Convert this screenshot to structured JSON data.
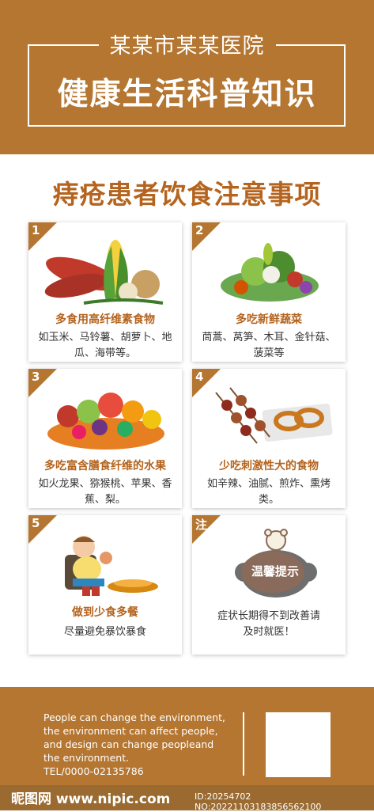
{
  "header": {
    "hospital": "某某市某某医院",
    "title": "健康生活科普知识"
  },
  "section_title": "痔疮患者饮食注意事项",
  "cards": [
    {
      "num": "1",
      "title": "多食用高纤维素食物",
      "desc": "如玉米、马铃薯、胡萝卜、地瓜、海带等。",
      "icon": "vegetables-illustration"
    },
    {
      "num": "2",
      "title": "多吃新鲜蔬菜",
      "desc": "茼蒿、莴笋、木耳、金针菇、菠菜等",
      "icon": "fresh-greens-illustration"
    },
    {
      "num": "3",
      "title": "多吃富含膳食纤维的水果",
      "desc": "如火龙果、猕猴桃、苹果、香蕉、梨。",
      "icon": "fruit-pile-illustration"
    },
    {
      "num": "4",
      "title": "少吃刺激性大的食物",
      "desc": "如辛辣、油腻、煎炸、熏烤类。",
      "icon": "skewers-illustration"
    },
    {
      "num": "5",
      "title": "做到少食多餐",
      "desc": "尽量避免暴饮暴食",
      "icon": "overeating-boy-illustration"
    },
    {
      "num": "注",
      "title": "",
      "desc": "症状长期得不到改善请及时就医！",
      "icon": "bear-tip-illustration",
      "bubble": "温馨提示"
    }
  ],
  "footer": {
    "lines": [
      "People can change the environment,",
      "the environment can affect people,",
      "and design can change peopleand",
      "the environment.",
      "TEL/0000-02135786"
    ]
  },
  "watermark": {
    "logo": "昵图网 www.nipic.com",
    "id": "ID:20254702 NO:20221103183856562100"
  }
}
